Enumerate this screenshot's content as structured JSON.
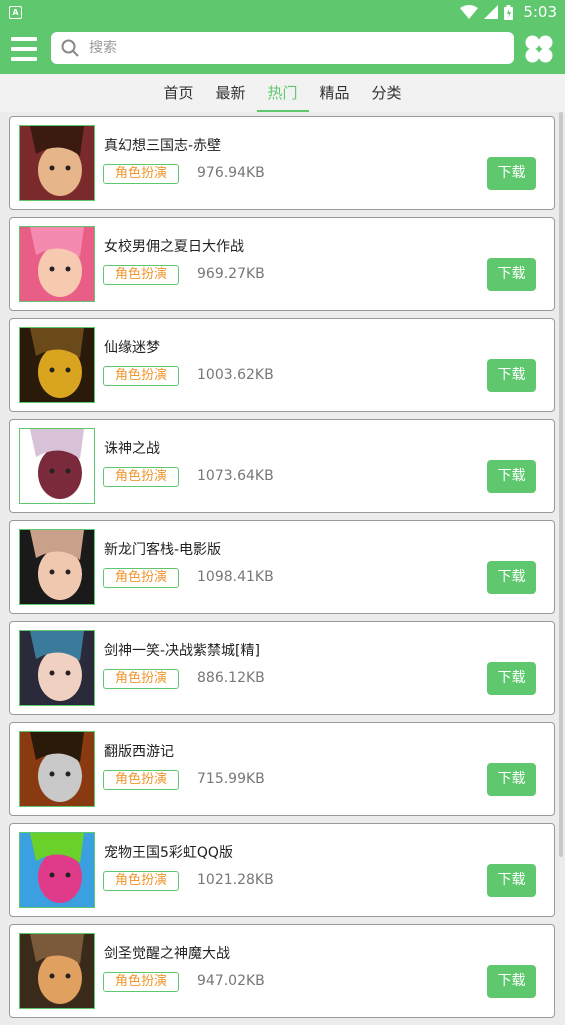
{
  "status_bar": {
    "notification_icon": "A",
    "time": "5:03"
  },
  "toolbar": {
    "search_placeholder": "搜索"
  },
  "tabs": [
    {
      "label": "首页",
      "active": false
    },
    {
      "label": "最新",
      "active": false
    },
    {
      "label": "热门",
      "active": true
    },
    {
      "label": "精品",
      "active": false
    },
    {
      "label": "分类",
      "active": false
    }
  ],
  "games": [
    {
      "name": "真幻想三国志-赤壁",
      "tag": "角色扮演",
      "size": "976.94KB",
      "download": "下载",
      "thumb_colors": [
        "#7a2a2a",
        "#e7b58a",
        "#3b1a10"
      ]
    },
    {
      "name": "女校男佣之夏日大作战",
      "tag": "角色扮演",
      "size": "969.27KB",
      "download": "下载",
      "thumb_colors": [
        "#e85e86",
        "#f7c9b0",
        "#f58ab0"
      ]
    },
    {
      "name": "仙缘迷梦",
      "tag": "角色扮演",
      "size": "1003.62KB",
      "download": "下载",
      "thumb_colors": [
        "#2a1a0a",
        "#d9a520",
        "#6b4a1a"
      ]
    },
    {
      "name": "诛神之战",
      "tag": "角色扮演",
      "size": "1073.64KB",
      "download": "下载",
      "thumb_colors": [
        "#ffffff",
        "#7a2a3a",
        "#d8c2d8"
      ]
    },
    {
      "name": "新龙门客栈-电影版",
      "tag": "角色扮演",
      "size": "1098.41KB",
      "download": "下载",
      "thumb_colors": [
        "#1a1a1a",
        "#f0c8b0",
        "#c9a08a"
      ]
    },
    {
      "name": "剑神一笑-决战紫禁城[精]",
      "tag": "角色扮演",
      "size": "886.12KB",
      "download": "下载",
      "thumb_colors": [
        "#2a2a3a",
        "#f0d0c0",
        "#3a7a9a"
      ]
    },
    {
      "name": "翻版西游记",
      "tag": "角色扮演",
      "size": "715.99KB",
      "download": "下载",
      "thumb_colors": [
        "#8a3a10",
        "#c9c9c9",
        "#2a1a0a"
      ]
    },
    {
      "name": "宠物王国5彩虹QQ版",
      "tag": "角色扮演",
      "size": "1021.28KB",
      "download": "下载",
      "thumb_colors": [
        "#3aa0e0",
        "#e03a8a",
        "#6ad02a"
      ]
    },
    {
      "name": "剑圣觉醒之神魔大战",
      "tag": "角色扮演",
      "size": "947.02KB",
      "download": "下载",
      "thumb_colors": [
        "#3a2a1a",
        "#e0a060",
        "#7a5a3a"
      ]
    }
  ],
  "colors": {
    "accent": "#5fc86e",
    "tag_text": "#f0962e",
    "background": "#ececec"
  }
}
